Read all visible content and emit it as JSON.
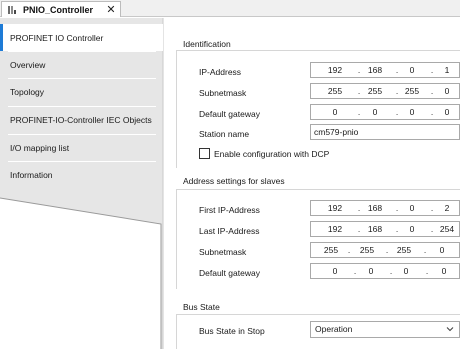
{
  "tab": {
    "title": "PNIO_Controller",
    "close_label": "✕"
  },
  "nav": {
    "items": [
      {
        "label": "PROFINET IO Controller",
        "active": true
      },
      {
        "label": "Overview"
      },
      {
        "label": "Topology"
      },
      {
        "label": "PROFINET-IO-Controller IEC Objects"
      },
      {
        "label": "I/O mapping list"
      },
      {
        "label": "Information"
      }
    ]
  },
  "identification": {
    "title": "Identification",
    "ip_address": {
      "label": "IP-Address",
      "octets": [
        "192",
        "168",
        "0",
        "1"
      ]
    },
    "subnetmask": {
      "label": "Subnetmask",
      "octets": [
        "255",
        "255",
        "255",
        "0"
      ]
    },
    "default_gateway": {
      "label": "Default gateway",
      "octets": [
        "0",
        "0",
        "0",
        "0"
      ]
    },
    "station_name": {
      "label": "Station name",
      "value": "cm579-pnio"
    },
    "dcp": {
      "label": "Enable configuration with DCP",
      "checked": false
    }
  },
  "slaves": {
    "title": "Address settings for slaves",
    "first_ip": {
      "label": "First IP-Address",
      "octets": [
        "192",
        "168",
        "0",
        "2"
      ]
    },
    "last_ip": {
      "label": "Last IP-Address",
      "octets": [
        "192",
        "168",
        "0",
        "254"
      ]
    },
    "subnetmask": {
      "label": "Subnetmask",
      "octets": [
        "255",
        "255",
        "255",
        "0"
      ]
    },
    "default_gateway": {
      "label": "Default gateway",
      "octets": [
        "0",
        "0",
        "0",
        "0"
      ]
    }
  },
  "bus_state": {
    "title": "Bus State",
    "stop_label": "Bus State in Stop",
    "stop_value": "Operation"
  },
  "ip_separator": "."
}
